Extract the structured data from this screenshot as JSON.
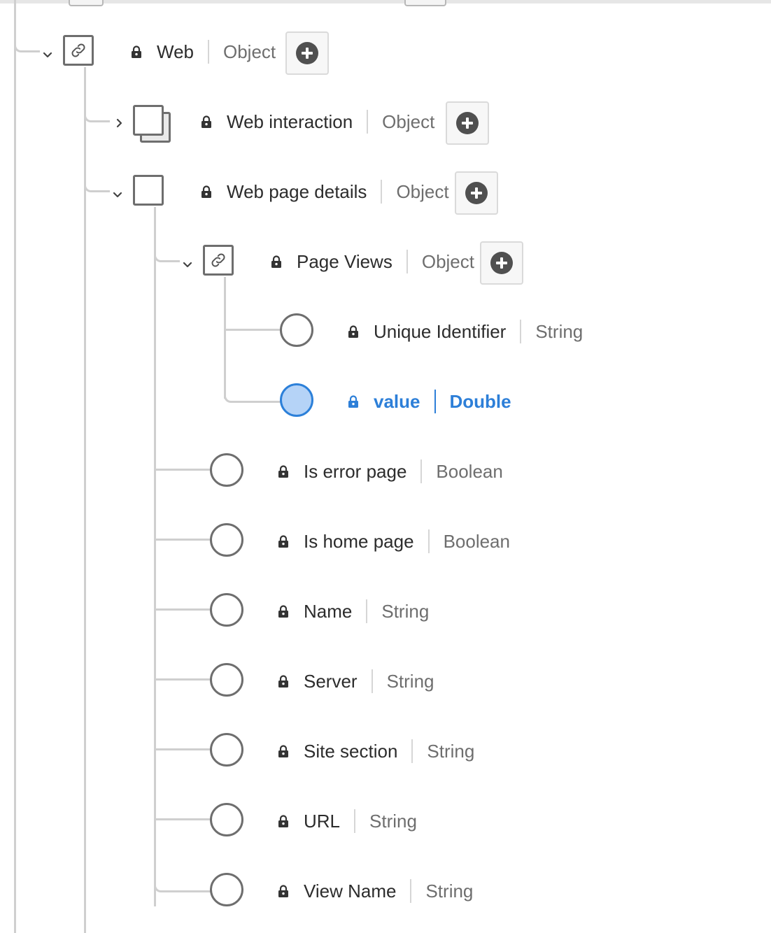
{
  "tree": {
    "web": {
      "name": "Web",
      "type": "Object"
    },
    "web_interaction": {
      "name": "Web interaction",
      "type": "Object"
    },
    "web_page_details": {
      "name": "Web page details",
      "type": "Object"
    },
    "page_views": {
      "name": "Page Views",
      "type": "Object"
    },
    "unique_identifier": {
      "name": "Unique Identifier",
      "type": "String"
    },
    "value": {
      "name": "value",
      "type": "Double",
      "selected": true
    },
    "is_error_page": {
      "name": "Is error page",
      "type": "Boolean"
    },
    "is_home_page": {
      "name": "Is home page",
      "type": "Boolean"
    },
    "name": {
      "name": "Name",
      "type": "String"
    },
    "server": {
      "name": "Server",
      "type": "String"
    },
    "site_section": {
      "name": "Site section",
      "type": "String"
    },
    "url": {
      "name": "URL",
      "type": "String"
    },
    "view_name": {
      "name": "View Name",
      "type": "String"
    }
  },
  "colors": {
    "selected_text": "#2d7fd8",
    "selected_fill": "#b5d3f7",
    "node_border": "#6e6e6e",
    "connector": "#cfcfcf"
  },
  "icons": {
    "lock": "lock-icon",
    "link": "link-icon",
    "add": "add-circle-icon",
    "expand": "chevron-down-icon",
    "collapse": "chevron-right-icon"
  }
}
